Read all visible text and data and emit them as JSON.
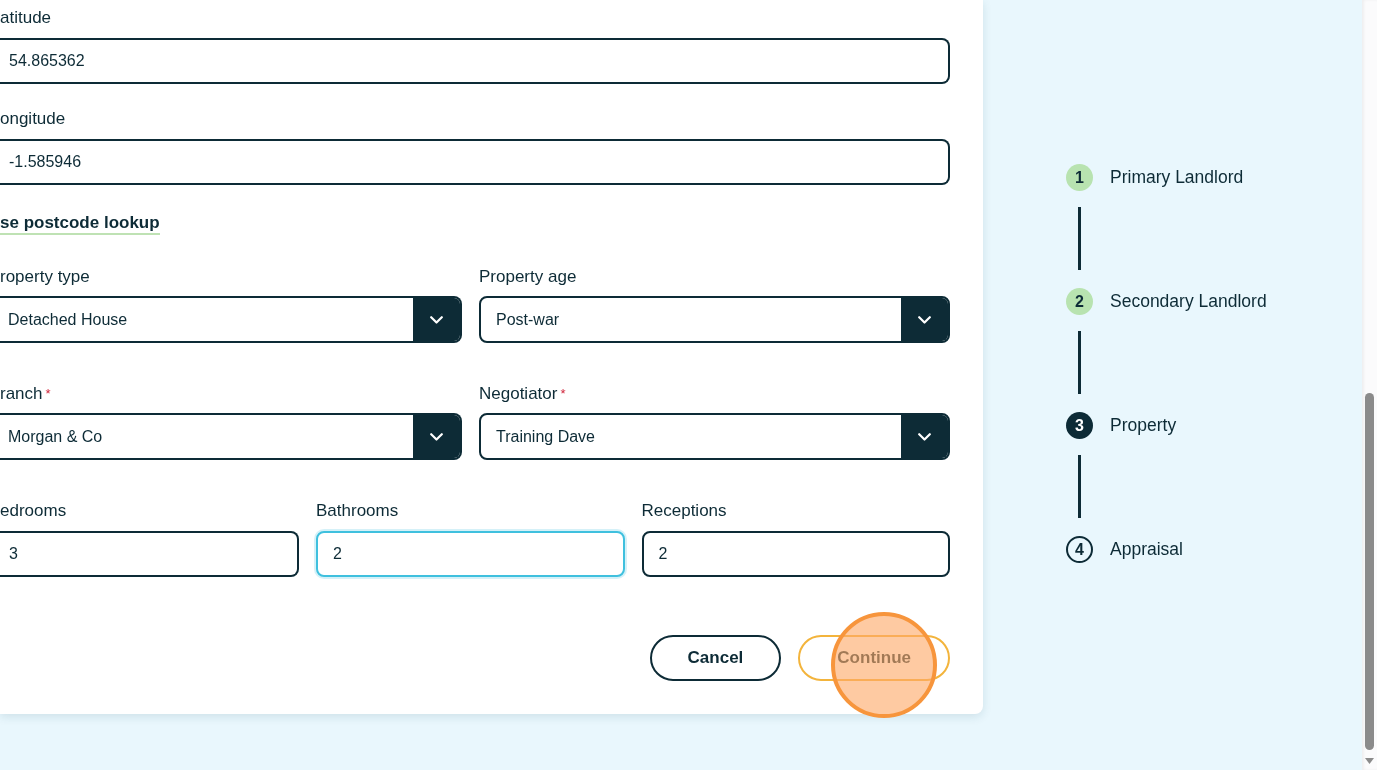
{
  "form": {
    "fields": [
      {
        "kind": "text",
        "label": "atitude",
        "value": "54.865362",
        "focused": false
      },
      {
        "kind": "text",
        "label": "ongitude",
        "value": "-1.585946",
        "focused": false
      }
    ],
    "postcode_link": "se postcode lookup",
    "rows": [
      {
        "fields": [
          {
            "kind": "select",
            "label": "roperty type",
            "value": "Detached House"
          },
          {
            "kind": "select",
            "label": "Property age",
            "value": "Post-war"
          }
        ]
      },
      {
        "fields": [
          {
            "kind": "select",
            "label": "ranch",
            "required_mark": "*",
            "value": "Morgan & Co"
          },
          {
            "kind": "select",
            "label": "Negotiator",
            "required_mark": "*",
            "value": "Training Dave"
          }
        ]
      },
      {
        "fields": [
          {
            "kind": "text",
            "label": "edrooms",
            "value": "3",
            "focused": false
          },
          {
            "kind": "text",
            "label": "Bathrooms",
            "value": "2",
            "focused": true
          },
          {
            "kind": "text",
            "label": "Receptions",
            "value": "2",
            "focused": false
          }
        ]
      }
    ],
    "buttons": [
      {
        "kind": "outline",
        "label": "Cancel",
        "click_marker": false
      },
      {
        "kind": "accent",
        "label": "Continue",
        "click_marker": true
      }
    ]
  },
  "stepper": {
    "steps": [
      {
        "number": "1",
        "label": "Primary Landlord",
        "completed": true,
        "selected": false
      },
      {
        "number": "2",
        "label": "Secondary Landlord",
        "completed": true,
        "selected": false
      },
      {
        "number": "3",
        "label": "Property",
        "completed": false,
        "selected": true
      },
      {
        "number": "4",
        "label": "Appraisal",
        "completed": false,
        "selected": false
      }
    ]
  }
}
